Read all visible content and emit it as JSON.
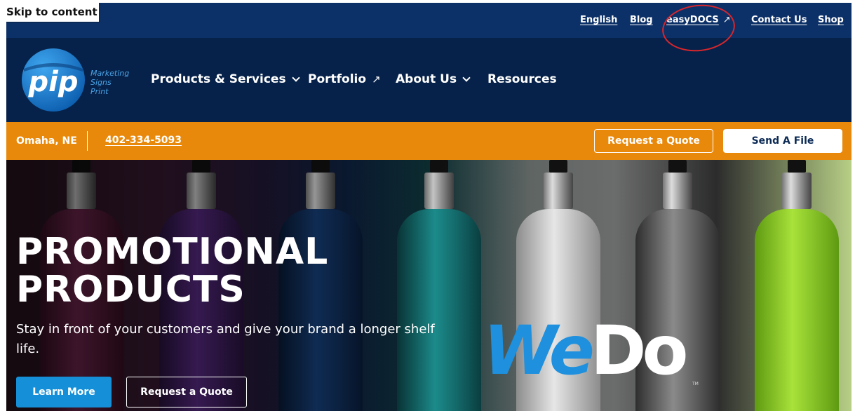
{
  "skip_link": "Skip to content",
  "utility_nav": {
    "english": "English",
    "blog": "Blog",
    "easydocs": "easyDOCS",
    "contact": "Contact Us",
    "shop": "Shop",
    "ext_arrow": "↗"
  },
  "brand": {
    "logo_text": "pip",
    "tagline": [
      "Marketing",
      "Signs",
      "Print"
    ]
  },
  "main_nav": {
    "products": "Products & Services",
    "portfolio": "Portfolio",
    "about": "About Us",
    "resources": "Resources",
    "ext_arrow": "↗"
  },
  "location_bar": {
    "city": "Omaha, NE",
    "phone": "402-334-5093",
    "request_quote": "Request a Quote",
    "send_file": "Send A File"
  },
  "hero": {
    "title_line1": "PROMOTIONAL",
    "title_line2": "PRODUCTS",
    "subtitle": "Stay in front of your customers and give your brand a longer shelf life.",
    "learn_more": "Learn More",
    "request_quote": "Request a Quote",
    "wedo_we": "We",
    "wedo_do": "Do",
    "wedo_tm": "TM"
  },
  "colors": {
    "utility_bg": "#0c3068",
    "nav_bg": "#06224a",
    "location_bg": "#e8890b",
    "accent_blue": "#1590d8",
    "annotation_red": "#d8262c"
  }
}
